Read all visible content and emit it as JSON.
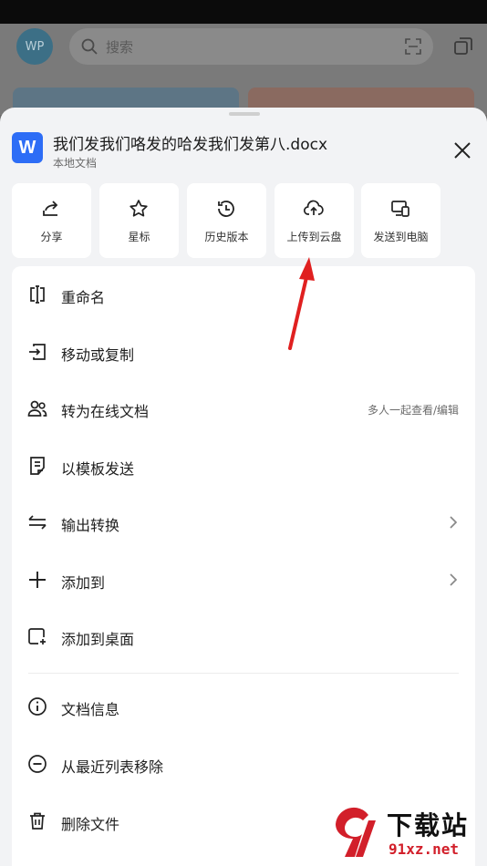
{
  "background": {
    "avatar_text": "WP",
    "search_placeholder": "搜索"
  },
  "sheet": {
    "file_icon_letter": "W",
    "file_name": "我们发我们咯发的哈发我们发第八.docx",
    "file_location": "本地文档",
    "actions": [
      {
        "label": "分享",
        "icon": "share-icon"
      },
      {
        "label": "星标",
        "icon": "star-icon"
      },
      {
        "label": "历史版本",
        "icon": "history-icon"
      },
      {
        "label": "上传到云盘",
        "icon": "cloud-upload-icon"
      },
      {
        "label": "发送到电脑",
        "icon": "send-to-pc-icon"
      }
    ],
    "menu": [
      {
        "label": "重命名",
        "icon": "rename-icon"
      },
      {
        "label": "移动或复制",
        "icon": "move-copy-icon"
      },
      {
        "label": "转为在线文档",
        "icon": "users-icon",
        "hint": "多人一起查看/编辑"
      },
      {
        "label": "以模板发送",
        "icon": "template-icon"
      },
      {
        "label": "输出转换",
        "icon": "convert-icon"
      },
      {
        "label": "添加到",
        "icon": "plus-icon"
      },
      {
        "label": "添加到桌面",
        "icon": "add-desktop-icon"
      },
      {
        "label": "文档信息",
        "icon": "info-icon"
      },
      {
        "label": "从最近列表移除",
        "icon": "remove-icon"
      },
      {
        "label": "删除文件",
        "icon": "trash-icon"
      }
    ]
  },
  "watermark": {
    "title": "下载站",
    "url": "91xz.net"
  },
  "colors": {
    "accent": "#2d6df6",
    "annotation_arrow": "#e02020"
  }
}
